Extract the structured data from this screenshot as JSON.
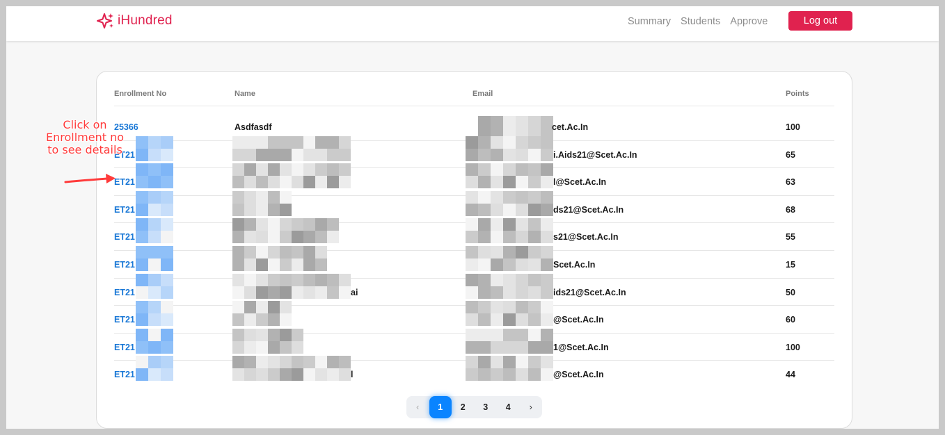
{
  "brand": {
    "name": "iHundred",
    "color": "#e0224f"
  },
  "nav": {
    "links": [
      "Summary",
      "Students",
      "Approve"
    ],
    "logout_label": "Log out"
  },
  "table": {
    "headers": {
      "enrollment": "Enrollment No",
      "name": "Name",
      "email": "Email",
      "points": "Points"
    },
    "rows": [
      {
        "enrollment": "25366",
        "name": "Asdfasdf",
        "email": "cet.Ac.In",
        "points": "100"
      },
      {
        "enrollment": "ET21",
        "name": "",
        "email": "i.Aids21@Scet.Ac.In",
        "points": "65"
      },
      {
        "enrollment": "ET21",
        "name": "",
        "email": "l@Scet.Ac.In",
        "points": "63"
      },
      {
        "enrollment": "ET21",
        "name": "",
        "email": "ds21@Scet.Ac.In",
        "points": "68"
      },
      {
        "enrollment": "ET21",
        "name": "",
        "email": "s21@Scet.Ac.In",
        "points": "55"
      },
      {
        "enrollment": "ET21",
        "name": "",
        "email": "Scet.Ac.In",
        "points": "15"
      },
      {
        "enrollment": "ET21",
        "name": "ai",
        "email": "ids21@Scet.Ac.In",
        "points": "50"
      },
      {
        "enrollment": "ET21",
        "name": "",
        "email": "@Scet.Ac.In",
        "points": "60"
      },
      {
        "enrollment": "ET21",
        "name": "",
        "email": "1@Scet.Ac.In",
        "points": "100"
      },
      {
        "enrollment": "ET21",
        "name": "l",
        "email": "@Scet.Ac.In",
        "points": "44"
      }
    ]
  },
  "pagination": {
    "prev": "‹",
    "pages": [
      "1",
      "2",
      "3",
      "4"
    ],
    "current": "1",
    "next": "›"
  },
  "annotation": {
    "line1": "Click on",
    "line2": "Enrollment no",
    "line3": "to see details",
    "color": "#ff3b3b"
  }
}
